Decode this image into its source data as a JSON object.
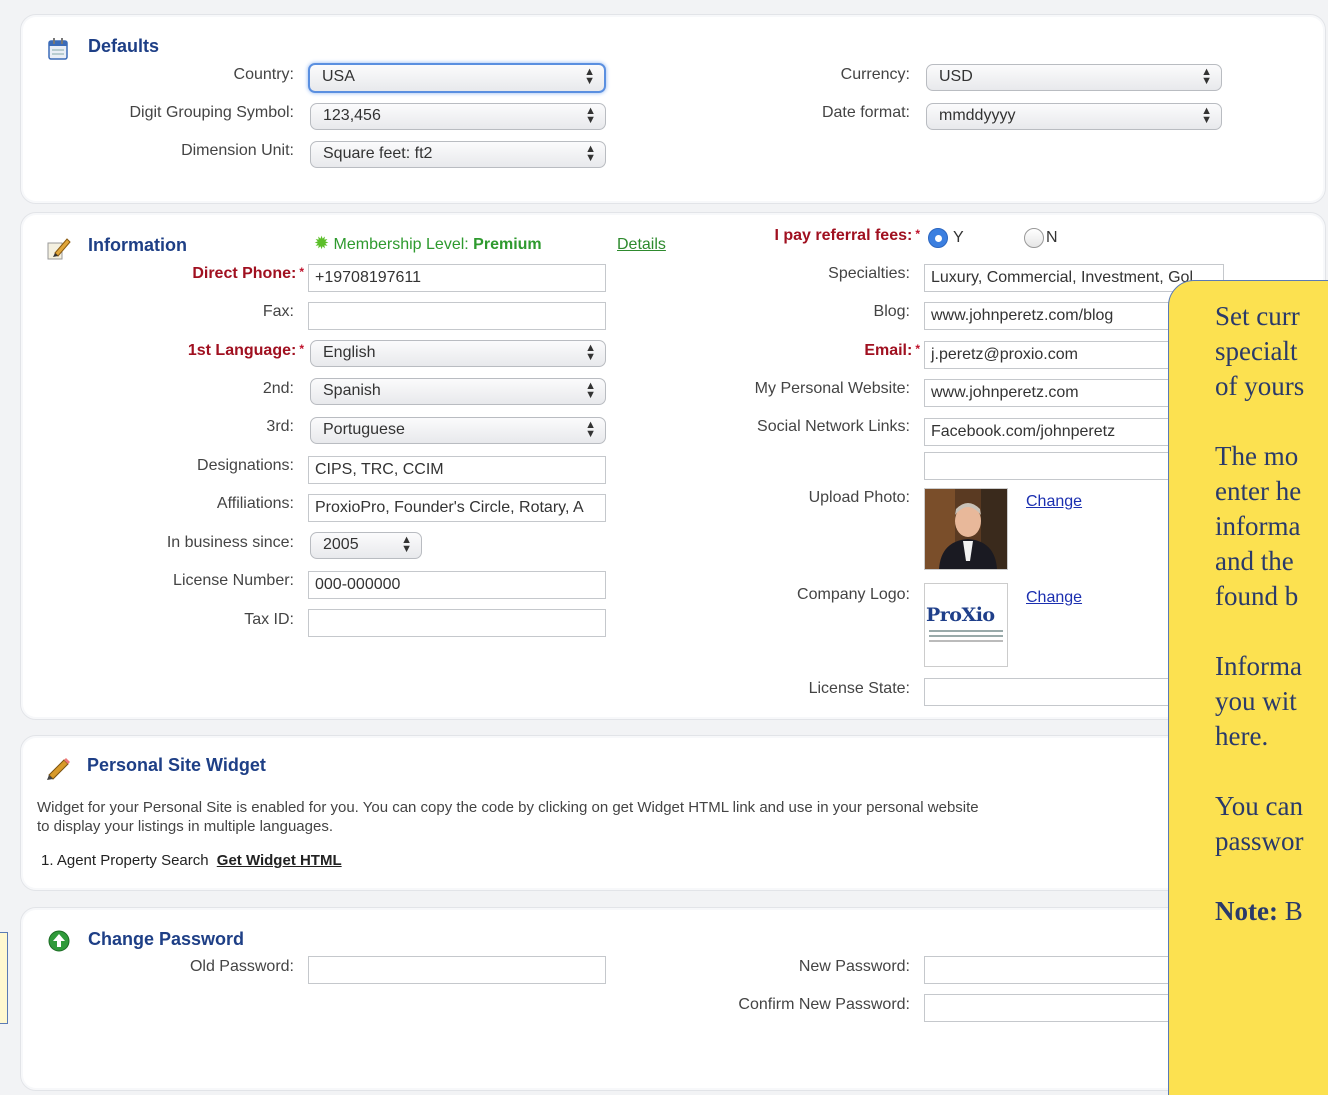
{
  "defaults": {
    "title": "Defaults",
    "country_label": "Country:",
    "country_value": "USA",
    "digit_label": "Digit Grouping Symbol:",
    "digit_value": "123,456",
    "dimension_label": "Dimension Unit:",
    "dimension_value": "Square feet: ft2",
    "currency_label": "Currency:",
    "currency_value": "USD",
    "date_label": "Date format:",
    "date_value": "mmddyyyy"
  },
  "information": {
    "title": "Information",
    "membership_label": "Membership Level:",
    "membership_value": "Premium",
    "details_link": "Details",
    "referral_label": "I pay referral fees:",
    "referral_yes": "Y",
    "referral_no": "N",
    "direct_phone_label": "Direct Phone:",
    "direct_phone_value": "+19708197611",
    "fax_label": "Fax:",
    "fax_value": "",
    "lang1_label": "1st Language:",
    "lang1_value": "English",
    "lang2_label": "2nd:",
    "lang2_value": "Spanish",
    "lang3_label": "3rd:",
    "lang3_value": "Portuguese",
    "designations_label": "Designations:",
    "designations_value": "CIPS, TRC, CCIM",
    "affiliations_label": "Affiliations:",
    "affiliations_value": "ProxioPro, Founder's Circle, Rotary, A",
    "business_since_label": "In business since:",
    "business_since_value": "2005",
    "license_label": "License Number:",
    "license_value": "000-000000",
    "tax_label": "Tax ID:",
    "tax_value": "",
    "specialties_label": "Specialties:",
    "specialties_value": "Luxury, Commercial, Investment, Gol",
    "blog_label": "Blog:",
    "blog_value": "www.johnperetz.com/blog",
    "email_label": "Email:",
    "email_value": "j.peretz@proxio.com",
    "website_label": "My Personal Website:",
    "website_value": "www.johnperetz.com",
    "social_label": "Social Network Links:",
    "social_value": "Facebook.com/johnperetz",
    "social_value2": "",
    "upload_photo_label": "Upload Photo:",
    "photo_change": "Change",
    "company_logo_label": "Company Logo:",
    "logo_change": "Change",
    "logo_text": "ProXio",
    "license_state_label": "License State:",
    "license_state_value": ""
  },
  "widget": {
    "title": "Personal Site Widget",
    "description_line1": "Widget for your Personal Site is enabled for you. You can copy the code by clicking on get Widget HTML link and use in your personal website",
    "description_line2": "to display your listings in multiple languages.",
    "item_label": "1. Agent Property Search",
    "item_link": "Get Widget HTML"
  },
  "password": {
    "title": "Change Password",
    "old_label": "Old Password:",
    "new_label": "New Password:",
    "confirm_label": "Confirm New Password:"
  },
  "note": {
    "p1_l1": "Set curr",
    "p1_l2": "specialt",
    "p1_l3": "of yours",
    "p2_l1": "The mo",
    "p2_l2": "enter he",
    "p2_l3": "informa",
    "p2_l4": "and the",
    "p2_l5": "found b",
    "p3_l1": "Informa",
    "p3_l2": "you wit",
    "p3_l3": "here.",
    "p4_l1": "You can",
    "p4_l2": "passwor",
    "p5_bold": "Note:",
    "p5_rest": " B"
  },
  "colors": {
    "section_title": "#1e3f86",
    "required": "#a01020",
    "membership": "#2e9a2e",
    "note_bg": "#fce150"
  }
}
